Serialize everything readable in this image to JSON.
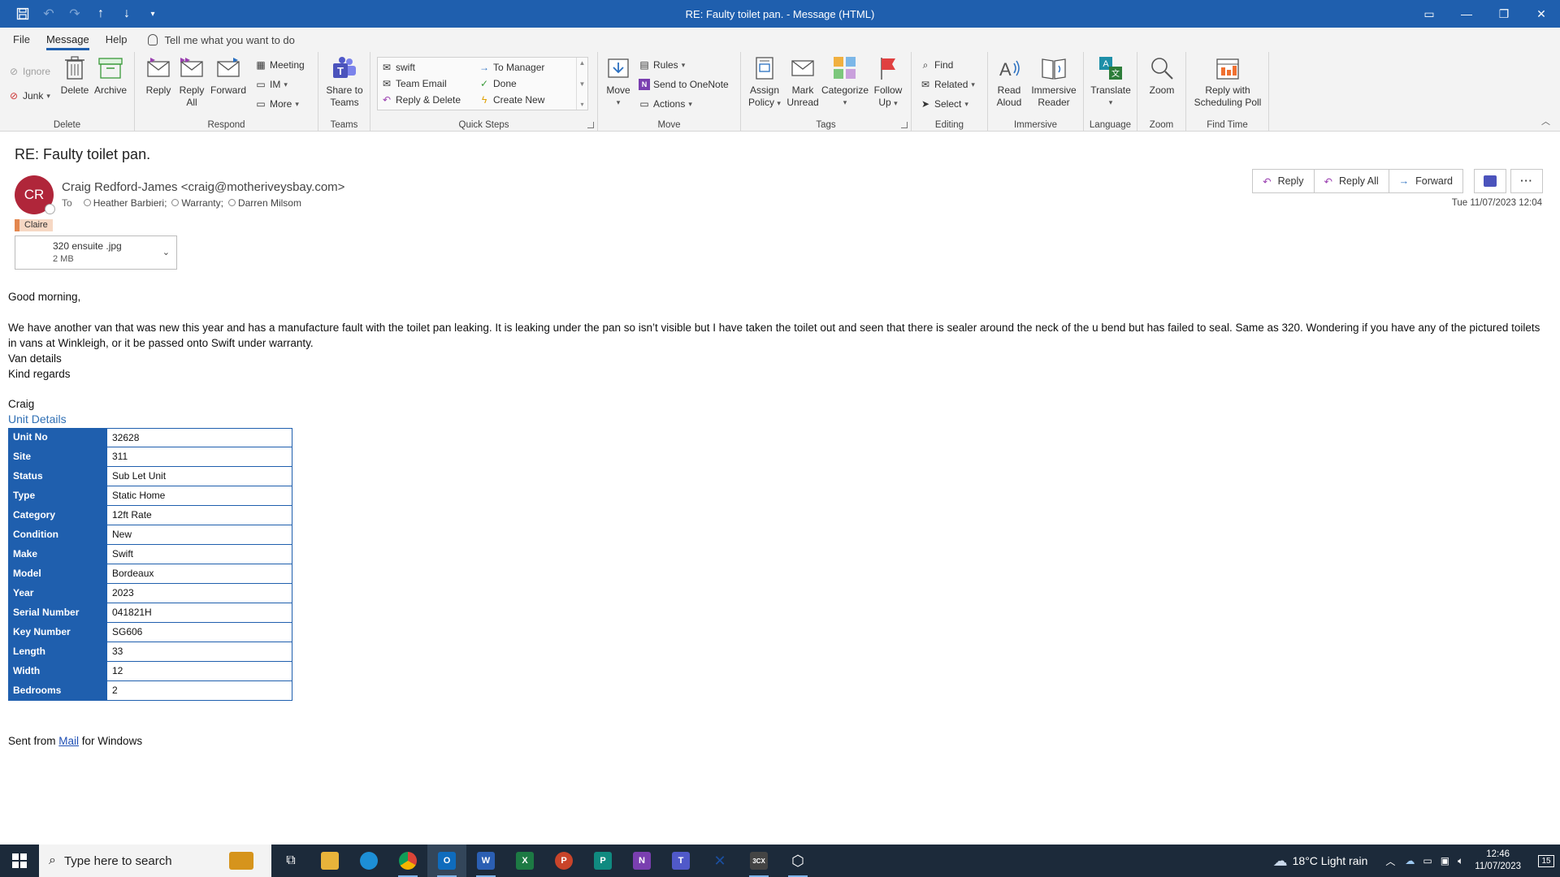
{
  "window": {
    "title": "RE: Faulty toilet pan.  - Message (HTML)"
  },
  "menu": {
    "tabs": [
      "File",
      "Message",
      "Help"
    ],
    "active_tab": "Message",
    "tell_me": "Tell me what you want to do"
  },
  "ribbon": {
    "delete_group": {
      "label": "Delete",
      "ignore": "Ignore",
      "junk": "Junk",
      "delete": "Delete",
      "archive": "Archive"
    },
    "respond_group": {
      "label": "Respond",
      "reply": "Reply",
      "reply_all_1": "Reply",
      "reply_all_2": "All",
      "forward": "Forward",
      "meeting": "Meeting",
      "im": "IM",
      "more": "More"
    },
    "teams_group": {
      "label": "Teams",
      "share_1": "Share to",
      "share_2": "Teams"
    },
    "quick_steps": {
      "label": "Quick Steps",
      "items": [
        "swift",
        "Team Email",
        "Reply & Delete",
        "To Manager",
        "Done",
        "Create New"
      ]
    },
    "move_group": {
      "label": "Move",
      "move": "Move",
      "rules": "Rules",
      "onenote": "Send to OneNote",
      "actions": "Actions"
    },
    "tags_group": {
      "label": "Tags",
      "assign_1": "Assign",
      "assign_2": "Policy",
      "mark_1": "Mark",
      "mark_2": "Unread",
      "categorize": "Categorize",
      "follow_1": "Follow",
      "follow_2": "Up"
    },
    "editing_group": {
      "label": "Editing",
      "find": "Find",
      "related": "Related",
      "select": "Select"
    },
    "immersive_group": {
      "label": "Immersive",
      "read_1": "Read",
      "read_2": "Aloud",
      "imm_1": "Immersive",
      "imm_2": "Reader"
    },
    "language_group": {
      "label": "Language",
      "translate": "Translate"
    },
    "zoom_group": {
      "label": "Zoom",
      "zoom": "Zoom"
    },
    "findtime_group": {
      "label": "Find Time",
      "poll_1": "Reply with",
      "poll_2": "Scheduling Poll"
    }
  },
  "message": {
    "subject": "RE: Faulty toilet pan.",
    "avatar_initials": "CR",
    "sender": "Craig Redford-James <craig@motheriveysbay.com>",
    "to_label": "To",
    "recipients": [
      "Heather Barbieri;",
      "Warranty;",
      "Darren Milsom"
    ],
    "category": "Claire",
    "timestamp": "Tue 11/07/2023 12:04",
    "attachment": {
      "name": "320 ensuite .jpg",
      "size": "2 MB"
    },
    "actions": {
      "reply": "Reply",
      "reply_all": "Reply All",
      "forward": "Forward"
    }
  },
  "body": {
    "greeting": "Good morning,",
    "paragraph": "We have another van that was new this year and has a manufacture fault with the toilet pan leaking. It is leaking under the pan so isn’t visible but I have taken the toilet out and seen that there is sealer around the neck of the u bend but has failed to seal.  Same as 320. Wondering if you have any of the pictured toilets in vans at Winkleigh, or it be passed onto Swift under warranty.",
    "van_details": "Van details",
    "kind_regards": "Kind regards",
    "signature": "Craig",
    "unit_title": "Unit Details",
    "unit_rows": [
      {
        "key": "Unit No",
        "value": "32628"
      },
      {
        "key": "Site",
        "value": "311"
      },
      {
        "key": "Status",
        "value": "Sub Let Unit"
      },
      {
        "key": "Type",
        "value": "Static Home"
      },
      {
        "key": "Category",
        "value": "12ft Rate"
      },
      {
        "key": "Condition",
        "value": "New"
      },
      {
        "key": "Make",
        "value": "Swift"
      },
      {
        "key": "Model",
        "value": "Bordeaux"
      },
      {
        "key": "Year",
        "value": "2023"
      },
      {
        "key": "Serial Number",
        "value": "041821H"
      },
      {
        "key": "Key Number",
        "value": "SG606"
      },
      {
        "key": "Length",
        "value": "33"
      },
      {
        "key": "Width",
        "value": "12"
      },
      {
        "key": "Bedrooms",
        "value": "2"
      }
    ],
    "sent_prefix": "Sent from ",
    "sent_link": "Mail",
    "sent_suffix": " for Windows"
  },
  "taskbar": {
    "search_placeholder": "Type here to search",
    "weather": "18°C  Light rain",
    "time": "12:46",
    "date": "11/07/2023",
    "notifications": "15"
  },
  "colors": {
    "accent": "#1f5fae",
    "avatar": "#b0263a",
    "table_header": "#1f5fae"
  }
}
